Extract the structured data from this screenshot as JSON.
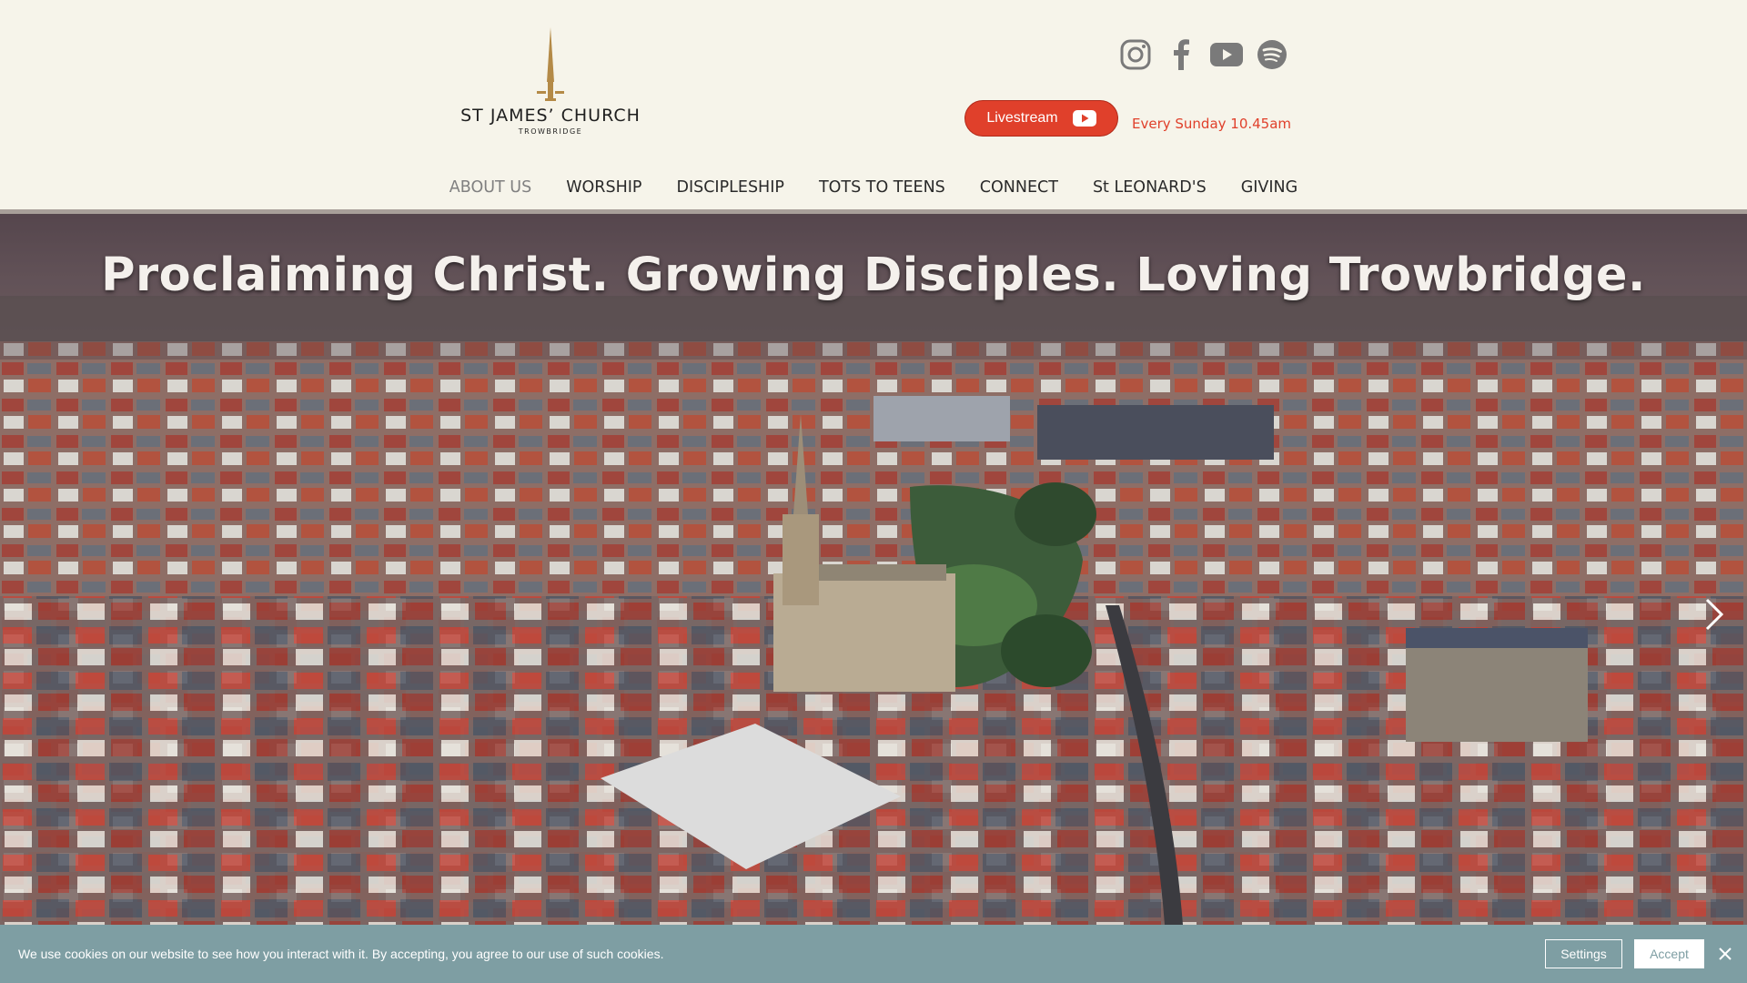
{
  "logo": {
    "title": "ST JAMES’ CHURCH",
    "subtitle": "TROWBRIDGE"
  },
  "social": {
    "icons": [
      "instagram-icon",
      "facebook-icon",
      "youtube-icon",
      "spotify-icon"
    ]
  },
  "livestream": {
    "label": "Livestream",
    "schedule": "Every Sunday 10.45am"
  },
  "nav": {
    "items": [
      "ABOUT US",
      "WORSHIP",
      "DISCIPLESHIP",
      "TOTS TO TEENS",
      "CONNECT",
      "St LEONARD'S",
      "GIVING"
    ],
    "active": "ABOUT US"
  },
  "hero": {
    "headline": "Proclaiming Christ. Growing Disciples. Loving Trowbridge."
  },
  "cookie": {
    "message": "We use cookies on our website to see how you interact with it. By accepting, you agree to our use of such cookies.",
    "settings_label": "Settings",
    "accept_label": "Accept"
  },
  "colors": {
    "background": "#f6f4ea",
    "accent_red": "#e0402b",
    "cookie_bar": "#7e9ea3",
    "logo_gold": "#b48a47"
  }
}
